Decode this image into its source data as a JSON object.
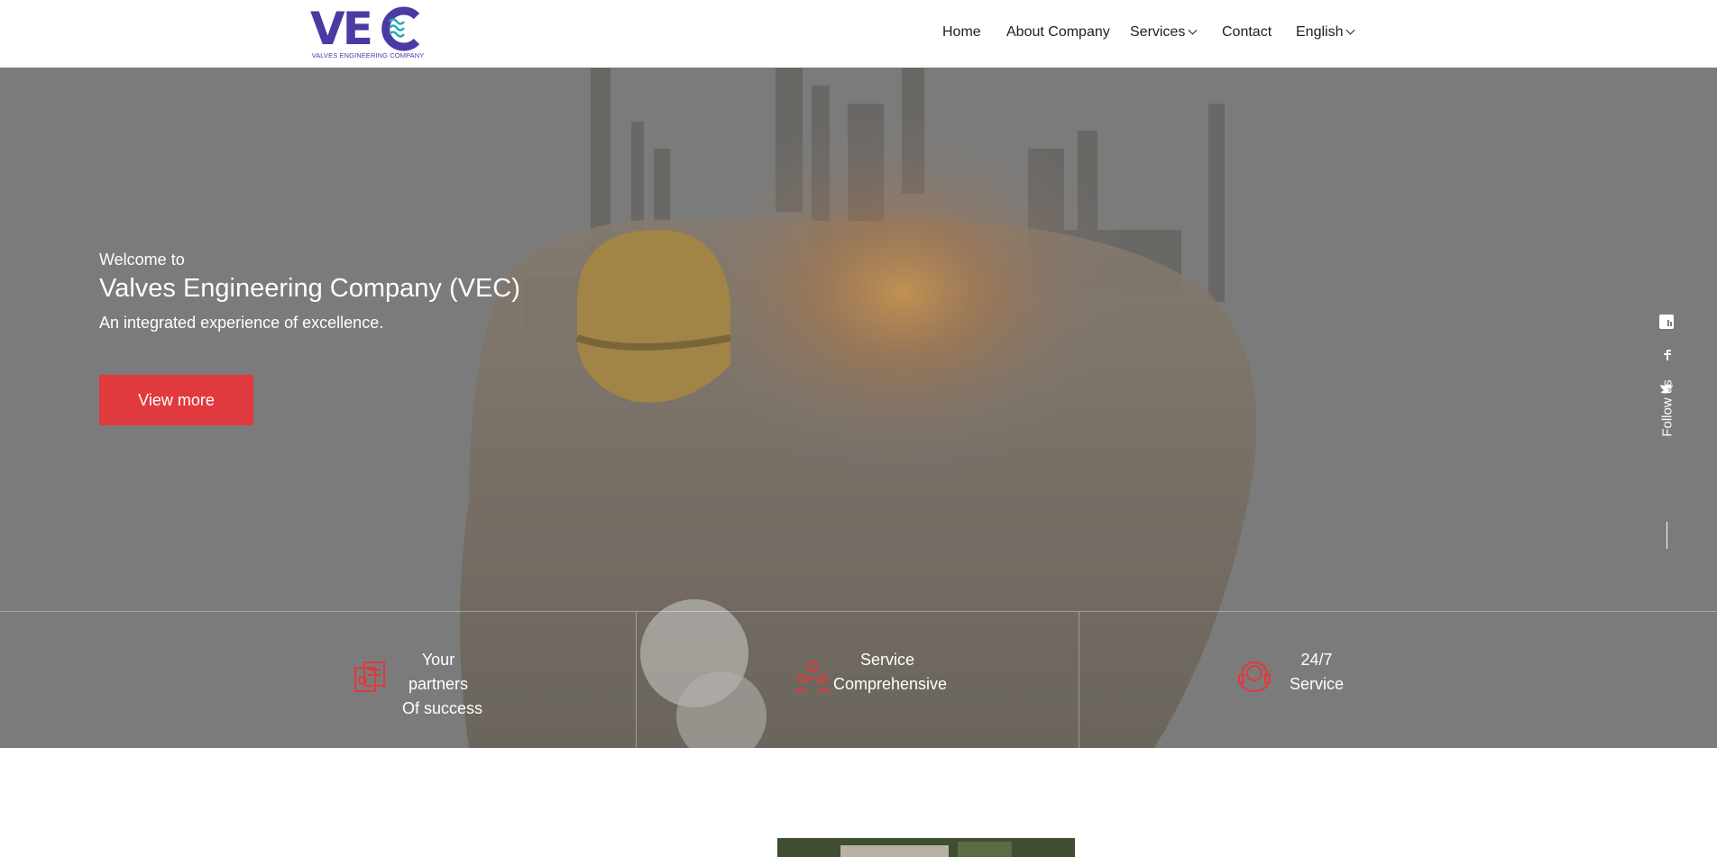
{
  "header": {
    "logo_text": "VEC",
    "logo_subtitle": "VALVES ENGINEERING COMPANY",
    "nav": [
      {
        "label": "Home"
      },
      {
        "label": "About Company"
      },
      {
        "label": "Services"
      },
      {
        "label": "Contact"
      },
      {
        "label": "English"
      }
    ]
  },
  "hero": {
    "welcome": "Welcome to",
    "title": "Valves Engineering Company (VEC)",
    "tagline": "An integrated experience of excellence.",
    "cta_label": "View more"
  },
  "social": {
    "follow_label": "Follow us",
    "icons": [
      "linkedin-icon",
      "facebook-icon",
      "twitter-icon"
    ]
  },
  "features": [
    {
      "icon": "partners-icon",
      "line1": "Your",
      "line2": "partners",
      "line3": "Of success"
    },
    {
      "icon": "team-service-icon",
      "line1": "Service",
      "line2": "Comprehensive"
    },
    {
      "icon": "support-24-7-icon",
      "line1": "24/7",
      "line2": "Service"
    }
  ],
  "colors": {
    "accent": "#e03a3e",
    "logo_purple": "#4b3aa3",
    "hero_overlay": "#7b7b7b"
  }
}
